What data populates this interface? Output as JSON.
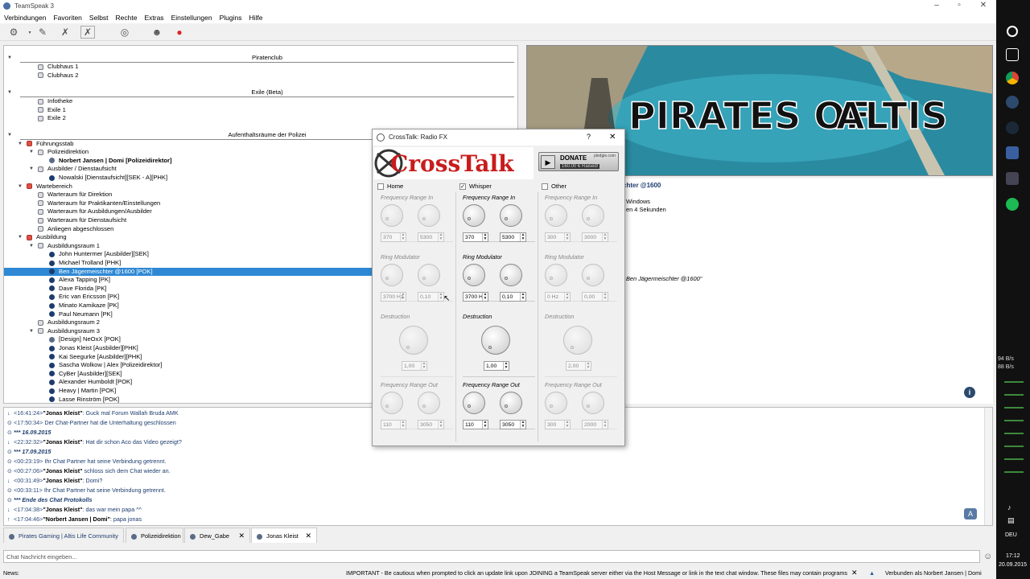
{
  "window": {
    "title": "TeamSpeak 3"
  },
  "menu": [
    "Verbindungen",
    "Favoriten",
    "Selbst",
    "Rechte",
    "Extras",
    "Einstellungen",
    "Plugins",
    "Hilfe"
  ],
  "tree": {
    "spacers": [
      "Piratenclub",
      "Exile (Beta)",
      "Aufenthaltsräume der Polizei"
    ],
    "piratenclub": [
      "Clubhaus 1",
      "Clubhaus 2"
    ],
    "exile": [
      "Infotheke",
      "Exile 1",
      "Exile 2"
    ],
    "polizei": [
      {
        "t": "Führungsstab",
        "k": "chanred",
        "lvl": 1
      },
      {
        "t": "Polizeidirektion",
        "k": "chan",
        "lvl": 2
      },
      {
        "t": "Norbert Jansen | Domi [Polizeidirektor]",
        "k": "user2",
        "lvl": 3,
        "b": true
      },
      {
        "t": "Ausbilder / Dienstaufsicht",
        "k": "chan",
        "lvl": 2
      },
      {
        "t": "Nowalski [Dienstaufsicht][SEK - A][PHK]",
        "k": "user",
        "lvl": 3
      },
      {
        "t": "Wartebereich",
        "k": "chanred",
        "lvl": 1
      },
      {
        "t": "Warteraum für Direktion",
        "k": "chan",
        "lvl": 2
      },
      {
        "t": "Warteraum für Praktikanten/Einstellungen",
        "k": "chan",
        "lvl": 2
      },
      {
        "t": "Warteraum für Ausbildungen/Ausbilder",
        "k": "chan",
        "lvl": 2
      },
      {
        "t": "Warteraum für Dienstaufsicht",
        "k": "chan",
        "lvl": 2
      },
      {
        "t": "Anliegen abgeschlossen",
        "k": "chan",
        "lvl": 2
      },
      {
        "t": "Ausbildung",
        "k": "chanred",
        "lvl": 1
      },
      {
        "t": "Ausbildungsraum 1",
        "k": "chan",
        "lvl": 2
      },
      {
        "t": "John Huntermer [Ausbilder][SEK]",
        "k": "user",
        "lvl": 3
      },
      {
        "t": "Michael Trolland [PHK]",
        "k": "user",
        "lvl": 3
      },
      {
        "t": "Ben Jägermeischter @1600 [POK]",
        "k": "user",
        "lvl": 3,
        "sel": true
      },
      {
        "t": "Alexa Tapping [PK]",
        "k": "user",
        "lvl": 3
      },
      {
        "t": "Dave Florida [PK]",
        "k": "user",
        "lvl": 3
      },
      {
        "t": "Eric van Ericsson [PK]",
        "k": "user",
        "lvl": 3
      },
      {
        "t": "Minato Kamikaze [PK]",
        "k": "user",
        "lvl": 3
      },
      {
        "t": "Paul Neumann [PK]",
        "k": "user",
        "lvl": 3
      },
      {
        "t": "Ausbildungsraum 2",
        "k": "chan",
        "lvl": 2
      },
      {
        "t": "Ausbildungsraum 3",
        "k": "chan",
        "lvl": 2
      },
      {
        "t": "[Design] NeOxX [POK]",
        "k": "user2",
        "lvl": 3
      },
      {
        "t": "Jonas Kleist [Ausbilder][PHK]",
        "k": "user",
        "lvl": 3
      },
      {
        "t": "Kai Seegurke [Ausbilder][PHK]",
        "k": "user",
        "lvl": 3
      },
      {
        "t": "Sascha Wolkow | Alex [Polizeidirektor]",
        "k": "user",
        "lvl": 3
      },
      {
        "t": "CyBer [Ausbilder][SEK]",
        "k": "user",
        "lvl": 3
      },
      {
        "t": "Alexander Humboldt [POK]",
        "k": "user",
        "lvl": 3
      },
      {
        "t": "Heavy | Martin [POK]",
        "k": "user",
        "lvl": 3
      },
      {
        "t": "Lasse Rinström [POK]",
        "k": "user",
        "lvl": 3
      }
    ]
  },
  "banner": {
    "text_a": "PIRATES OF ",
    "text_b": "ALTIS"
  },
  "info": {
    "name": "chter @1600",
    "line1": "Windows",
    "line2": "en 4 Sekunden",
    "quote": "Ben Jägermeischter @1600\""
  },
  "chat": [
    {
      "i": "↓",
      "ts": "<16:41:24>",
      "who": "\"Jonas Kleist\"",
      "msg": ": Guck mal Forum Wallah Bruda AMK"
    },
    {
      "i": "i",
      "ts": "<17:50:34>",
      "who": "",
      "msg": " Der Chat-Partner hat die Unterhaltung geschlossen"
    },
    {
      "i": "i",
      "ts": "*** 16.09.2015",
      "who": "",
      "msg": "",
      "bold": true
    },
    {
      "i": "↓",
      "ts": "<22:32:32>",
      "who": "\"Jonas Kleist\"",
      "msg": ": Hat dir schon Aco das Video gezeigt?"
    },
    {
      "i": "i",
      "ts": "*** 17.09.2015",
      "who": "",
      "msg": "",
      "bold": true
    },
    {
      "i": "i",
      "ts": "<00:23:19>",
      "who": "",
      "msg": " Ihr Chat Partner hat seine Verbindung getrennt."
    },
    {
      "i": "i",
      "ts": "<00:27:06>",
      "who": "\"Jonas Kleist\"",
      "msg": " schloss sich dem Chat wieder an."
    },
    {
      "i": "↓",
      "ts": "<00:31:49>",
      "who": "\"Jonas Kleist\"",
      "msg": ": Domi?"
    },
    {
      "i": "i",
      "ts": "<00:33:11>",
      "who": "",
      "msg": " Ihr Chat Partner hat seine Verbindung getrennt."
    },
    {
      "i": "i",
      "ts": "*** Ende des Chat Protokolls",
      "who": "",
      "msg": "",
      "bold": true
    },
    {
      "i": "↓",
      "ts": "<17:04:38>",
      "who": "\"Jonas Kleist\"",
      "msg": ": das war mein papa ^^"
    },
    {
      "i": "↑",
      "ts": "<17:04:46>",
      "who": "\"Norbert Jansen | Domi\"",
      "msg": ": papa jonas"
    }
  ],
  "tabs": [
    "Pirates Gaming | Altis Life Community",
    "Polizeidirektion",
    "Dew_Gabe",
    "Jonas Kleist"
  ],
  "chat_input": {
    "placeholder": "Chat Nachricht eingeben..."
  },
  "status": {
    "news": "News:",
    "important": "IMPORTANT - Be cautious when prompted to click an update link upon JOINING a TeamSpeak server either via the Host Message or link in the text chat window. These files may contain programs",
    "connected": "Verbunden als Norbert Jansen | Domi"
  },
  "dialog": {
    "title": "CrossTalk: Radio FX",
    "help": "?",
    "close": "✕",
    "logo": "CrossTalk",
    "donate": "DONATE",
    "pledgie": "pledgie.com",
    "raised": "160.00 € Raised!",
    "columns": [
      {
        "name": "Home",
        "checked": false,
        "enabled": false,
        "fin": [
          "370",
          "5300"
        ],
        "ring": [
          "3700 Hz",
          "0,10"
        ],
        "destr": "1,00",
        "fout": [
          "110",
          "3050"
        ]
      },
      {
        "name": "Whisper",
        "checked": true,
        "enabled": true,
        "fin": [
          "370",
          "5300"
        ],
        "ring": [
          "3700 H",
          "0,10"
        ],
        "destr": "1,00",
        "fout": [
          "110",
          "3050"
        ]
      },
      {
        "name": "Other",
        "checked": false,
        "enabled": false,
        "fin": [
          "300",
          "3000"
        ],
        "ring": [
          "0 Hz",
          "0,00"
        ],
        "destr": "2,00",
        "fout": [
          "300",
          "2000"
        ]
      }
    ],
    "labels": {
      "fin": "Frequency Range In",
      "ring": "Ring Modulator",
      "destr": "Destruction",
      "fout": "Frequency Range Out"
    }
  },
  "taskbar": {
    "speed1": "94 B/s",
    "speed2": "88 B/s",
    "lang": "DEU",
    "time": "17:12",
    "date": "20.09.2015"
  }
}
